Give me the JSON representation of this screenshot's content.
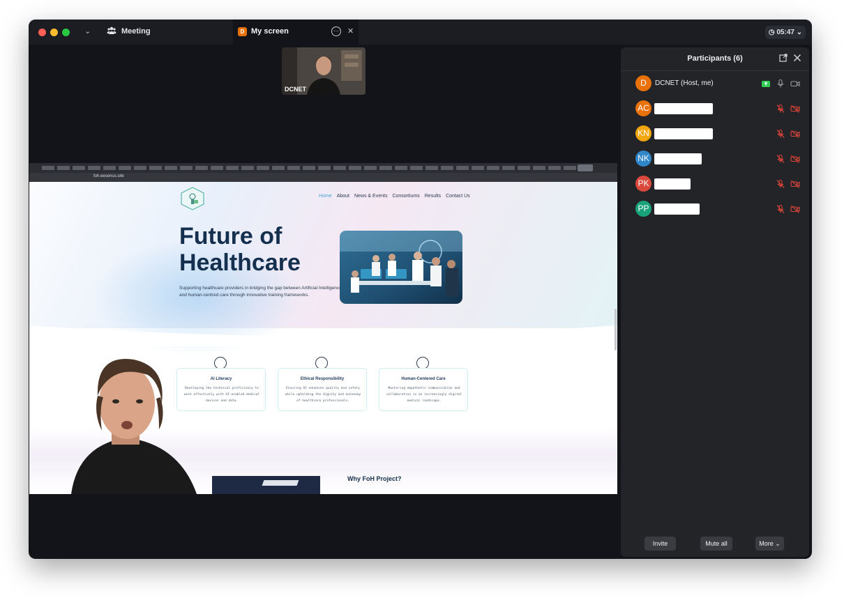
{
  "titlebar": {
    "meeting_label": "Meeting",
    "tab_badge": "D",
    "tab_label": "My screen",
    "timer": "05:47"
  },
  "self_video": {
    "name": "DCNET"
  },
  "shared_screen": {
    "url": "foh.eesenus.site",
    "nav": [
      "Home",
      "About",
      "News & Events",
      "Consortiums",
      "Results",
      "Contact Us"
    ],
    "hero_title_line1": "Future of",
    "hero_title_line2": "Healthcare",
    "hero_desc": "Supporting healthcare providers in bridging the gap between Artificial Intelligence and human-centred care through innovative training frameworks.",
    "cards": [
      {
        "title": "AI Literacy",
        "text": "Developing the technical proficiency to work effectively with AI-enabled medical devices and data."
      },
      {
        "title": "Ethical Responsibility",
        "text": "Ensuring AI enhances quality and safety while upholding the dignity and autonomy of healthcare professionals."
      },
      {
        "title": "Human-Centered Care",
        "text": "Mastering empathetic communication and collaboration in an increasingly digital medical landscape."
      }
    ],
    "why_title": "Why FoH Project?"
  },
  "participants": {
    "title": "Participants (6)",
    "list": [
      {
        "initials": "D",
        "name": "DCNET (Host, me)",
        "color": "#e8710a"
      },
      {
        "initials": "AC",
        "name": "",
        "color": "#e8710a"
      },
      {
        "initials": "KN",
        "name": "",
        "color": "#f2a60d"
      },
      {
        "initials": "NK",
        "name": "",
        "color": "#2f86c8"
      },
      {
        "initials": "PK",
        "name": "",
        "color": "#d9483b"
      },
      {
        "initials": "PP",
        "name": "",
        "color": "#1aa37a"
      }
    ],
    "buttons": {
      "invite": "Invite",
      "mute_all": "Mute all",
      "more": "More"
    }
  },
  "colors": {
    "muted_red": "#e0453a",
    "share_green": "#2ecc52",
    "window_bg": "#121419",
    "panel_bg": "#232427"
  }
}
